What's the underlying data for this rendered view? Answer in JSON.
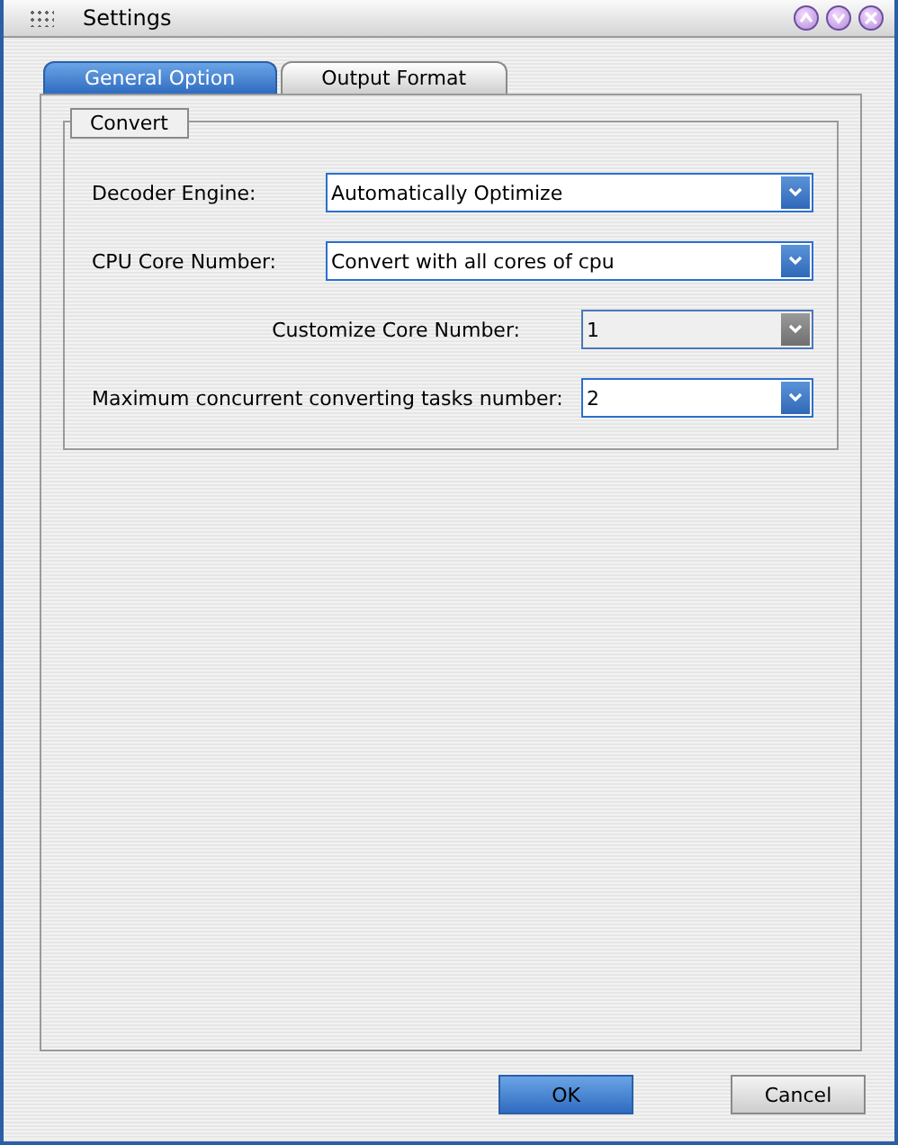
{
  "window": {
    "title": "Settings"
  },
  "tabs": [
    {
      "label": "General Option",
      "selected": true
    },
    {
      "label": "Output Format",
      "selected": false
    }
  ],
  "group": {
    "title": "Convert"
  },
  "fields": [
    {
      "label": "Decoder Engine:",
      "value": "Automatically Optimize",
      "kind": "wide",
      "disabled": false
    },
    {
      "label": "CPU Core Number:",
      "value": "Convert with all cores of cpu",
      "kind": "wide",
      "disabled": false
    },
    {
      "label": "Customize Core Number:",
      "value": "1",
      "kind": "narrow",
      "disabled": true
    },
    {
      "label": "Maximum concurrent converting tasks number:",
      "value": "2",
      "kind": "narrow",
      "disabled": false
    }
  ],
  "buttons": [
    {
      "label": "OK",
      "kind": "primary"
    },
    {
      "label": "Cancel",
      "kind": "secondary"
    }
  ]
}
